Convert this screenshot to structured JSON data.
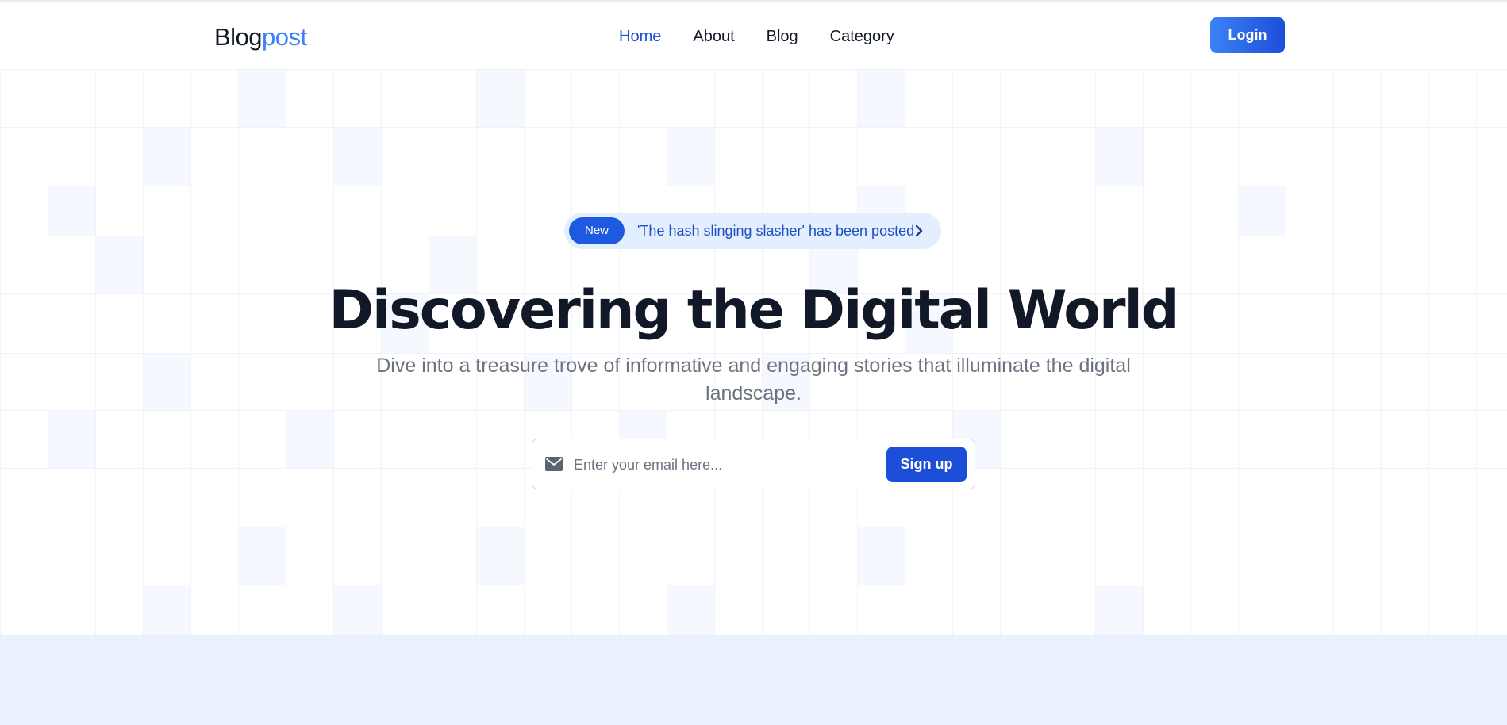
{
  "brand": {
    "part1": "Blog",
    "part2": "post"
  },
  "nav": {
    "items": [
      {
        "label": "Home",
        "active": true
      },
      {
        "label": "About",
        "active": false
      },
      {
        "label": "Blog",
        "active": false
      },
      {
        "label": "Category",
        "active": false
      }
    ],
    "login_label": "Login"
  },
  "hero": {
    "badge": "New",
    "announcement": "'The hash slinging slasher' has been posted",
    "headline": "Discovering the Digital World",
    "subtitle": "Dive into a treasure trove of informative and engaging stories that illuminate the digital landscape.",
    "email_placeholder": "Enter your email here...",
    "signup_label": "Sign up"
  },
  "icons": {
    "email": "mail-icon",
    "announcement": "chevron-right-icon"
  },
  "colors": {
    "accent": "#1d4ed8",
    "brand_accent": "#3b82f6",
    "text_dark": "#111827",
    "text_muted": "#6b7280",
    "announcement_bg": "#e3efff",
    "footer_band": "#e8f1fd"
  }
}
